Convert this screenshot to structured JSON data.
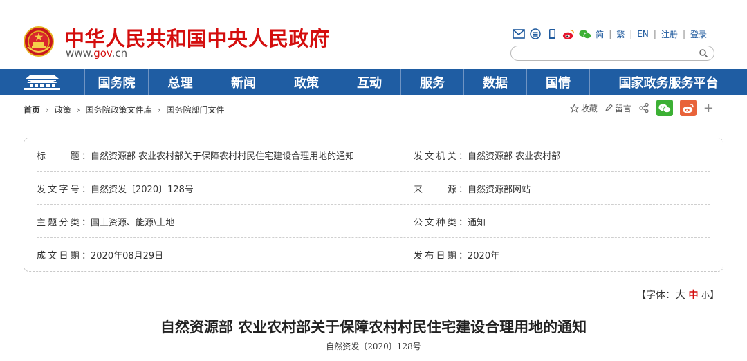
{
  "header": {
    "site_title": "中华人民共和国中央人民政府",
    "domain_prefix": "www.",
    "domain_highlight": "gov",
    "domain_suffix": ".cn",
    "links": [
      "简",
      "繁",
      "EN",
      "注册",
      "登录"
    ],
    "icons": [
      "mail-icon",
      "menu-icon",
      "mobile-icon",
      "weibo-icon",
      "wechat-icon"
    ],
    "search_placeholder": ""
  },
  "nav": {
    "home_icon": "tiananmen-icon",
    "items": [
      "国务院",
      "总理",
      "新闻",
      "政策",
      "互动",
      "服务",
      "数据",
      "国情",
      "国家政务服务平台"
    ]
  },
  "breadcrumb": {
    "items": [
      "首页",
      "政策",
      "国务院政策文件库",
      "国务院部门文件"
    ]
  },
  "tools": {
    "favorite": "收藏",
    "comment": "留言"
  },
  "info": {
    "rows": [
      {
        "l_label": "标　　题：",
        "l_value": "自然资源部 农业农村部关于保障农村村民住宅建设合理用地的通知",
        "r_label": "发文机关：",
        "r_value": "自然资源部 农业农村部"
      },
      {
        "l_label": "发文字号：",
        "l_value": "自然资发〔2020〕128号",
        "r_label": "来　　源：",
        "r_value": "自然资源部网站"
      },
      {
        "l_label": "主题分类：",
        "l_value": "国土资源、能源\\土地",
        "r_label": "公文种类：",
        "r_value": "通知"
      },
      {
        "l_label": "成文日期：",
        "l_value": "2020年08月29日",
        "r_label": "发布日期：",
        "r_value": "2020年"
      }
    ]
  },
  "font_switch": {
    "prefix": "【字体：",
    "large": "大",
    "medium": "中",
    "small": "小",
    "suffix": "】"
  },
  "article": {
    "title": "自然资源部 农业农村部关于保障农村村民住宅建设合理用地的通知",
    "doc_number": "自然资发〔2020〕128号"
  },
  "colors": {
    "brand_red": "#d40e0e",
    "nav_blue": "#1f5da3",
    "link_blue": "#1f5a9e"
  }
}
